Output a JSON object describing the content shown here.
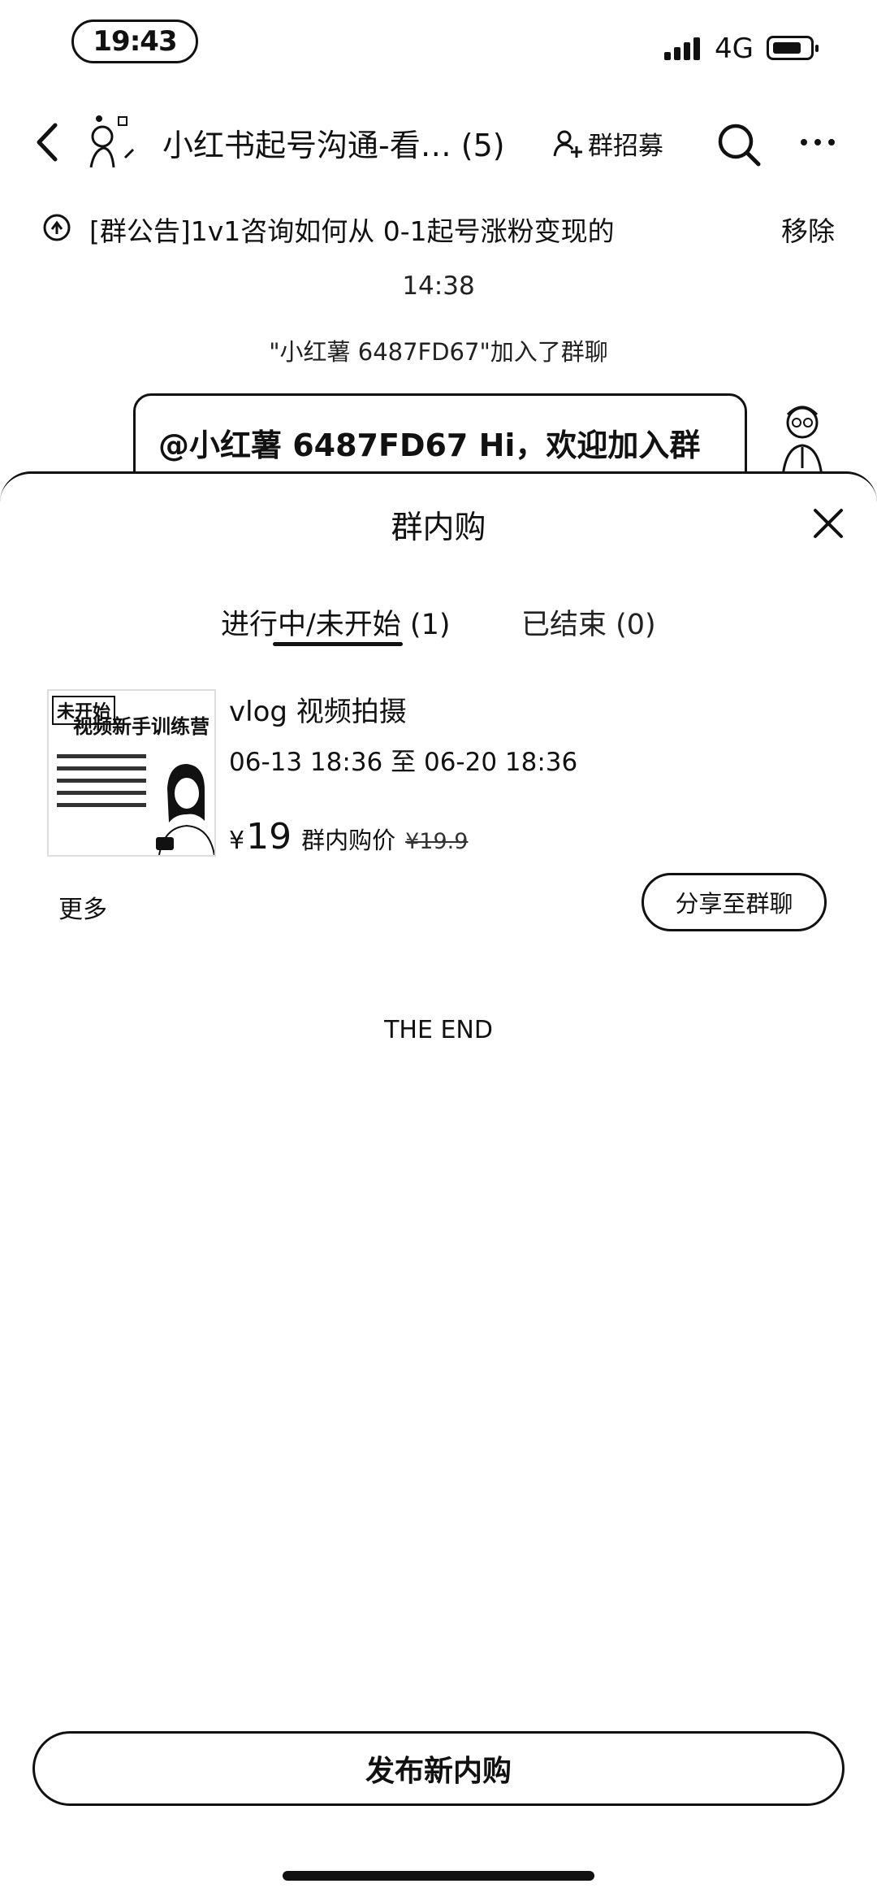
{
  "status_bar": {
    "time": "19:43",
    "network": "4G"
  },
  "header": {
    "title": "小红书起号沟通-看… (5)",
    "recruit_label": "群招募"
  },
  "notice": {
    "text": "[群公告]1v1咨询如何从 0-1起号涨粉变现的",
    "remove_label": "移除"
  },
  "chat": {
    "time": "14:38",
    "join_message": "\"小红薯 6487FD67\"加入了群聊",
    "bubble_text": "@小红薯 6487FD67 Hi，欢迎加入群"
  },
  "sheet": {
    "title": "群内购",
    "tabs": [
      {
        "label": "进行中/未开始 (1)"
      },
      {
        "label": "已结束 (0)"
      }
    ],
    "product": {
      "thumb_tag": "未开始",
      "thumb_title": "视频新手训练营",
      "title": "vlog 视频拍摄",
      "dates": "06-13 18:36 至 06-20 18:36",
      "currency": "¥",
      "price": "19",
      "price_label": "群内购价",
      "original_price": "¥19.9"
    },
    "more_label": "更多",
    "share_label": "分享至群聊",
    "end_text": "THE END",
    "publish_label": "发布新内购"
  }
}
